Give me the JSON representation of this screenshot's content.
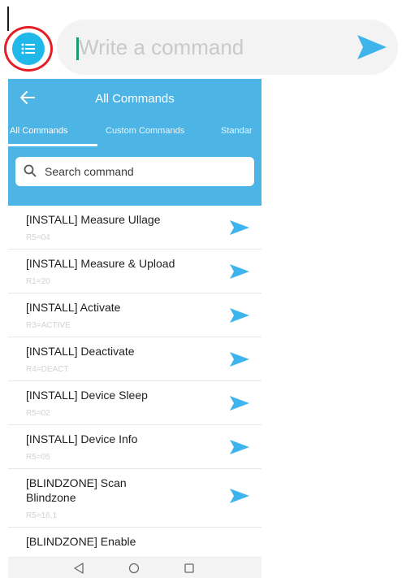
{
  "command_bar": {
    "placeholder": "Write a command"
  },
  "panel": {
    "title": "All Commands",
    "tabs": [
      {
        "label": "All Commands"
      },
      {
        "label": "Custom Commands"
      },
      {
        "label": "Standar"
      }
    ],
    "search_placeholder": "Search command"
  },
  "commands": [
    {
      "title": "[INSTALL] Measure Ullage",
      "code": "R5=04"
    },
    {
      "title": "[INSTALL] Measure & Upload",
      "code": "R1=20"
    },
    {
      "title": "[INSTALL] Activate",
      "code": "R3=ACTIVE"
    },
    {
      "title": "[INSTALL] Deactivate",
      "code": "R4=DEACT"
    },
    {
      "title": "[INSTALL] Device Sleep",
      "code": "R5=02"
    },
    {
      "title": "[INSTALL] Device Info",
      "code": "R5=05"
    },
    {
      "title": "[BLINDZONE] Scan Blindzone",
      "code": "R5=16,1"
    },
    {
      "title": "[BLINDZONE] Enable",
      "code": ""
    }
  ],
  "colors": {
    "accent": "#20b8e8",
    "header": "#4cb5e6",
    "send": "#3eb4ec",
    "highlight_ring": "#e3202a"
  },
  "icons": {
    "menu": "list-icon",
    "send": "send-icon",
    "back": "arrow-left-icon",
    "search": "search-icon",
    "nav_back": "triangle-back-icon",
    "nav_home": "circle-home-icon",
    "nav_recent": "square-recent-icon"
  }
}
